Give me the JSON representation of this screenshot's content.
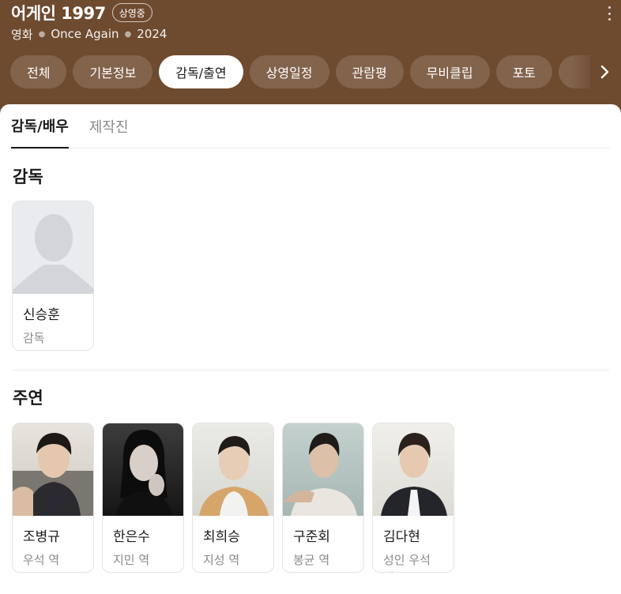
{
  "header": {
    "title": "어게인 1997",
    "status_badge": "상영중",
    "meta": [
      "영화",
      "Once Again",
      "2024"
    ],
    "background_color": "#6e4a2f",
    "more_icon": "more-vertical-icon"
  },
  "tabs": [
    {
      "label": "전체",
      "active": false
    },
    {
      "label": "기본정보",
      "active": false
    },
    {
      "label": "감독/출연",
      "active": true
    },
    {
      "label": "상영일정",
      "active": false
    },
    {
      "label": "관람평",
      "active": false
    },
    {
      "label": "무비클립",
      "active": false
    },
    {
      "label": "포토",
      "active": false
    }
  ],
  "subtabs": [
    {
      "label": "감독/배우",
      "active": true
    },
    {
      "label": "제작진",
      "active": false
    }
  ],
  "director_section": {
    "title": "감독",
    "people": [
      {
        "name": "신승훈",
        "role": "감독",
        "photo": "placeholder-silhouette-icon"
      }
    ]
  },
  "cast_section": {
    "title": "주연",
    "people": [
      {
        "name": "조병규",
        "role": "우석 역",
        "photo": "actor-photo"
      },
      {
        "name": "한은수",
        "role": "지민 역",
        "photo": "actor-photo"
      },
      {
        "name": "최희승",
        "role": "지성 역",
        "photo": "actor-photo"
      },
      {
        "name": "구준회",
        "role": "봉균 역",
        "photo": "actor-photo"
      },
      {
        "name": "김다현",
        "role": "성인 우석 역",
        "photo": "actor-photo"
      }
    ]
  }
}
